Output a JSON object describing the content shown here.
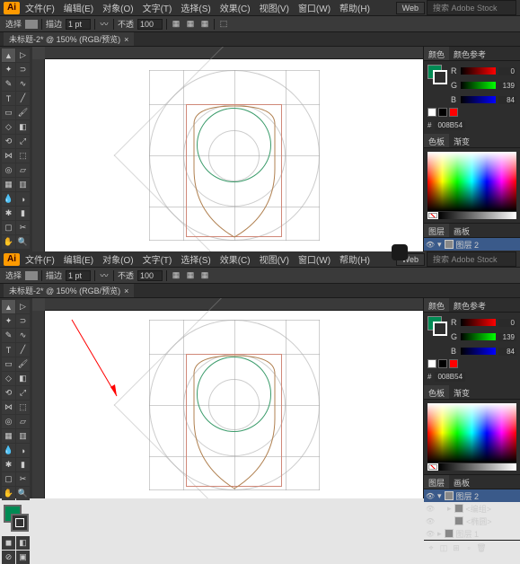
{
  "app": {
    "logo": "Ai",
    "menus": [
      "文件(F)",
      "编辑(E)",
      "对象(O)",
      "文字(T)",
      "选择(S)",
      "效果(C)",
      "视图(V)",
      "窗口(W)",
      "帮助(H)"
    ],
    "workspace_preset": "Web",
    "search_placeholder": "搜索 Adobe Stock"
  },
  "toolbar": {
    "label_tool": "选择",
    "stroke_label": "描边",
    "stroke_value": "1 pt",
    "opacity_label": "不透",
    "opacity": "100"
  },
  "doc_tab": {
    "title": "未标题-2* @ 150% (RGB/预览)",
    "close": "×"
  },
  "color": {
    "tab_color": "颜色",
    "tab_guide": "颜色参考",
    "tab_swatch": "色板",
    "tab_grad": "渐变",
    "labels": [
      "R",
      "G",
      "B"
    ],
    "r": "0",
    "g": "139",
    "b": "84",
    "hex": "008B54"
  },
  "layers": {
    "tab_layers": "图层",
    "tab_artboards": "画板",
    "top_layer": "图层 2",
    "group": "<编组>",
    "ellipse": "<椭圆>",
    "layer1": "图层 1"
  },
  "fill_color": "#008B54",
  "annotation_arrow": true
}
